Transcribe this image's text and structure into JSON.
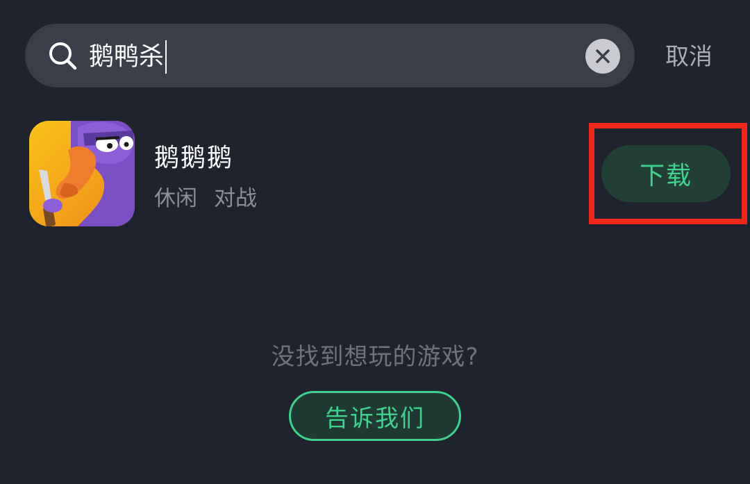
{
  "search": {
    "query": "鹅鸭杀",
    "cancel_label": "取消"
  },
  "result": {
    "app_name": "鹅鹅鹅",
    "tags": [
      "休闲",
      "对战"
    ],
    "download_label": "下载"
  },
  "empty_hint": {
    "message": "没找到想玩的游戏?",
    "button_label": "告诉我们"
  },
  "colors": {
    "background": "#1f232d",
    "search_bg": "#3a3e49",
    "accent_green": "#3fd28e",
    "highlight_red": "#f0281b"
  }
}
